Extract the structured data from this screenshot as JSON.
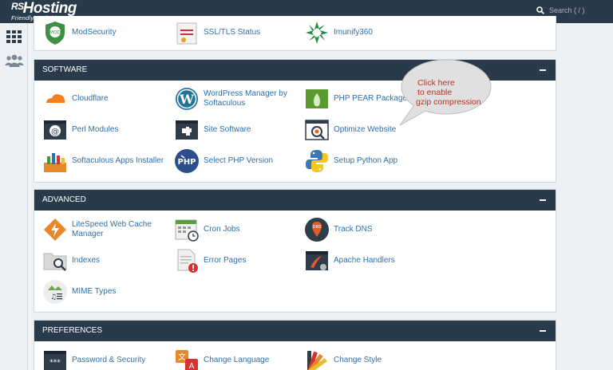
{
  "brand": {
    "rs": "RS",
    "name": "Hosting",
    "tagline": "Friendly. Reliable. Secure."
  },
  "search": {
    "placeholder": "Search ( / )"
  },
  "rail": {
    "icons": [
      "grid-icon",
      "users-icon"
    ]
  },
  "security_partial": {
    "items": [
      {
        "label": "ModSecurity",
        "icon": "modsecurity-icon"
      },
      {
        "label": "SSL/TLS Status",
        "icon": "ssl-certificate-icon"
      },
      {
        "label": "Imunify360",
        "icon": "imunify-icon"
      }
    ]
  },
  "software": {
    "title": "SOFTWARE",
    "items": [
      {
        "label": "Cloudflare",
        "icon": "cloudflare-icon"
      },
      {
        "label": "WordPress Manager by Softaculous",
        "line1": "WordPress Manager by",
        "line2": "Softaculous",
        "icon": "wordpress-icon"
      },
      {
        "label": "PHP PEAR Packages",
        "icon": "php-pear-icon"
      },
      {
        "label": "Perl Modules",
        "icon": "perl-icon"
      },
      {
        "label": "Site Software",
        "icon": "site-software-icon"
      },
      {
        "label": "Optimize Website",
        "icon": "optimize-website-icon"
      },
      {
        "label": "Softaculous Apps Installer",
        "icon": "softaculous-icon"
      },
      {
        "label": "Select PHP Version",
        "icon": "php-version-icon"
      },
      {
        "label": "Setup Python App",
        "icon": "python-icon"
      }
    ]
  },
  "advanced": {
    "title": "ADVANCED",
    "items": [
      {
        "label": "LiteSpeed Web Cache Manager",
        "line1": "LiteSpeed Web Cache",
        "line2": "Manager",
        "icon": "litespeed-icon"
      },
      {
        "label": "Cron Jobs",
        "icon": "cron-calendar-icon"
      },
      {
        "label": "Track DNS",
        "icon": "track-dns-icon"
      },
      {
        "label": "Indexes",
        "icon": "indexes-icon"
      },
      {
        "label": "Error Pages",
        "icon": "error-pages-icon"
      },
      {
        "label": "Apache Handlers",
        "icon": "apache-handlers-icon"
      },
      {
        "label": "MIME Types",
        "icon": "mime-types-icon"
      }
    ]
  },
  "preferences": {
    "title": "PREFERENCES",
    "items": [
      {
        "label": "Password & Security",
        "icon": "password-icon"
      },
      {
        "label": "Change Language",
        "icon": "language-icon"
      },
      {
        "label": "Change Style",
        "icon": "style-icon"
      }
    ]
  },
  "callout": {
    "line1": "Click here",
    "line2": "to enable",
    "line3": "gzip compression"
  },
  "colors": {
    "header": "#293a4a",
    "link": "#2c6fad",
    "callout_text": "#cc2b1e"
  }
}
